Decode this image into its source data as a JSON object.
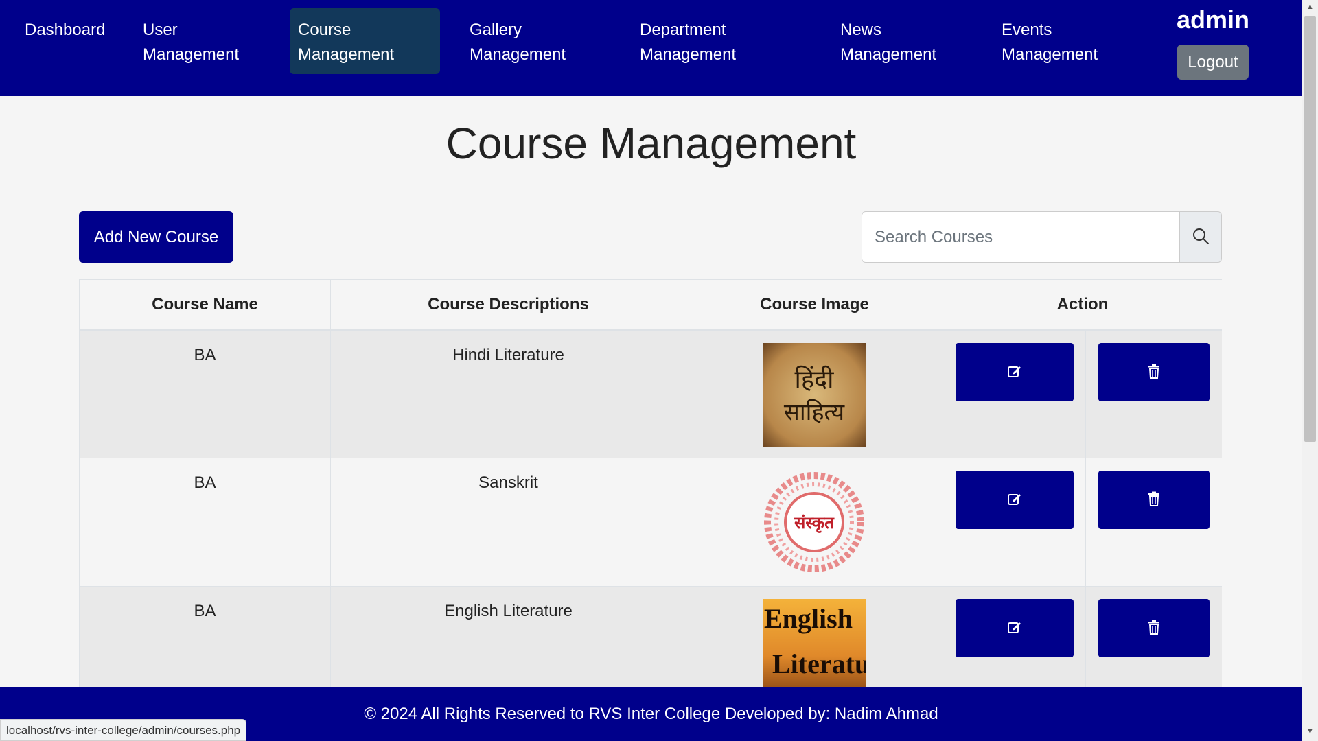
{
  "nav": {
    "items": [
      {
        "line1": "Dashboard",
        "line2": ""
      },
      {
        "line1": "User",
        "line2": "Management"
      },
      {
        "line1": "Course",
        "line2": "Management"
      },
      {
        "line1": "Gallery",
        "line2": "Management"
      },
      {
        "line1": "Department",
        "line2": "Management"
      },
      {
        "line1": "News",
        "line2": "Management"
      },
      {
        "line1": "Events",
        "line2": "Management"
      }
    ],
    "active_index": 2,
    "admin_name": "admin",
    "logout_label": "Logout"
  },
  "page": {
    "title": "Course Management",
    "add_button_label": "Add New Course",
    "search_placeholder": "Search Courses",
    "search_value": ""
  },
  "table": {
    "headers": [
      "Course Name",
      "Course Descriptions",
      "Course Image",
      "Action"
    ],
    "rows": [
      {
        "name": "BA",
        "description": "Hindi Literature",
        "image_text_1": "हिंदी",
        "image_text_2": "साहित्य"
      },
      {
        "name": "BA",
        "description": "Sanskrit",
        "image_text_1": "संस्कृत",
        "image_text_2": ""
      },
      {
        "name": "BA",
        "description": "English Literature",
        "image_text_1": "English",
        "image_text_2": "Literature"
      }
    ],
    "edit_icon": "edit-icon",
    "delete_icon": "trash-icon"
  },
  "footer": {
    "text": "© 2024 All Rights Reserved to RVS Inter College Developed by: Nadim Ahmad"
  },
  "status_bar": {
    "url": "localhost/rvs-inter-college/admin/courses.php"
  },
  "colors": {
    "primary": "#00008b",
    "active_nav": "#12385a",
    "logout": "#6c757d"
  }
}
